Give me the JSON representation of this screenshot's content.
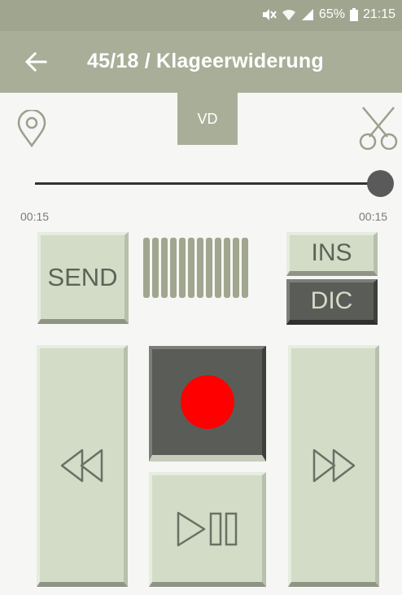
{
  "status_bar": {
    "battery": "65%",
    "time": "21:15",
    "icons": [
      "mute-vibrate-icon",
      "wifi-icon",
      "signal-icon",
      "battery-icon"
    ]
  },
  "app_bar": {
    "title": "45/18 / Klageerwiderung",
    "back_icon": "back-arrow-icon"
  },
  "tabs": {
    "vd_label": "VD"
  },
  "playback": {
    "position_label": "00:15",
    "duration_label": "00:15",
    "progress": 1.0
  },
  "controls": {
    "send_label": "SEND",
    "ins_label": "INS",
    "dic_label": "DIC",
    "level_meter_bars": 12,
    "record_icon": "record-icon",
    "rewind_icon": "rewind-icon",
    "fast_forward_icon": "fast-forward-icon",
    "play_pause_icon": "play-pause-icon"
  },
  "colors": {
    "header_bg": "#a9ae98",
    "button_light": "#d3dcc6",
    "button_dark": "#5a5d57",
    "record_red": "#ff0000"
  }
}
